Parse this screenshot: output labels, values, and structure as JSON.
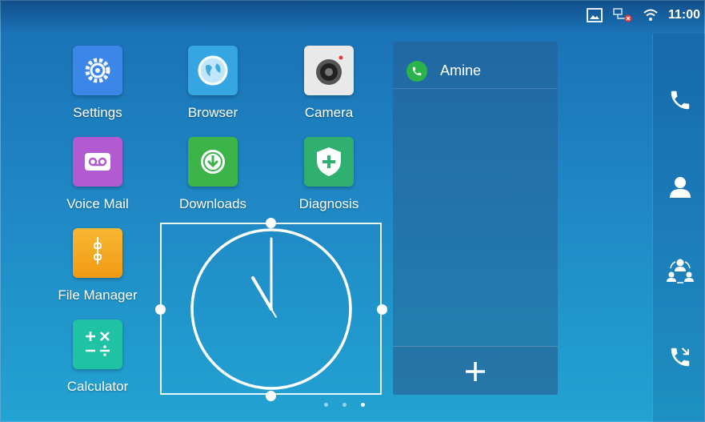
{
  "status_bar": {
    "time": "11:00",
    "icons": [
      "screenshot-icon",
      "network-disconnected-icon",
      "wifi-icon"
    ]
  },
  "apps": [
    {
      "label": "Settings",
      "icon": "gear-icon",
      "color": "#3b86e6"
    },
    {
      "label": "Browser",
      "icon": "globe-icon",
      "color": "#36a6e3"
    },
    {
      "label": "Camera",
      "icon": "camera-icon",
      "color": "#e9e9e9"
    },
    {
      "label": "Voice Mail",
      "icon": "voicemail-icon",
      "color": "#b25ad1"
    },
    {
      "label": "Downloads",
      "icon": "download-icon",
      "color": "#3cb44a"
    },
    {
      "label": "Diagnosis",
      "icon": "shield-plus-icon",
      "color": "#2fb06f"
    },
    {
      "label": "File Manager",
      "icon": "folder-icon",
      "color": "#f5a623"
    },
    {
      "label": "Calculator",
      "icon": "calculator-icon",
      "color": "#1fc2a4"
    }
  ],
  "clock_widget": {
    "time_shown": "11:00",
    "selected": true
  },
  "call_panel": {
    "contact": "Amine",
    "contact_icon": "phone-icon",
    "contact_icon_color": "#2bb44a",
    "add_icon": "plus-icon"
  },
  "right_sidebar": {
    "icons": [
      "phone-icon",
      "contact-icon",
      "group-icon",
      "call-transfer-icon"
    ]
  },
  "page_indicator": {
    "pages": 3,
    "current": 3
  }
}
